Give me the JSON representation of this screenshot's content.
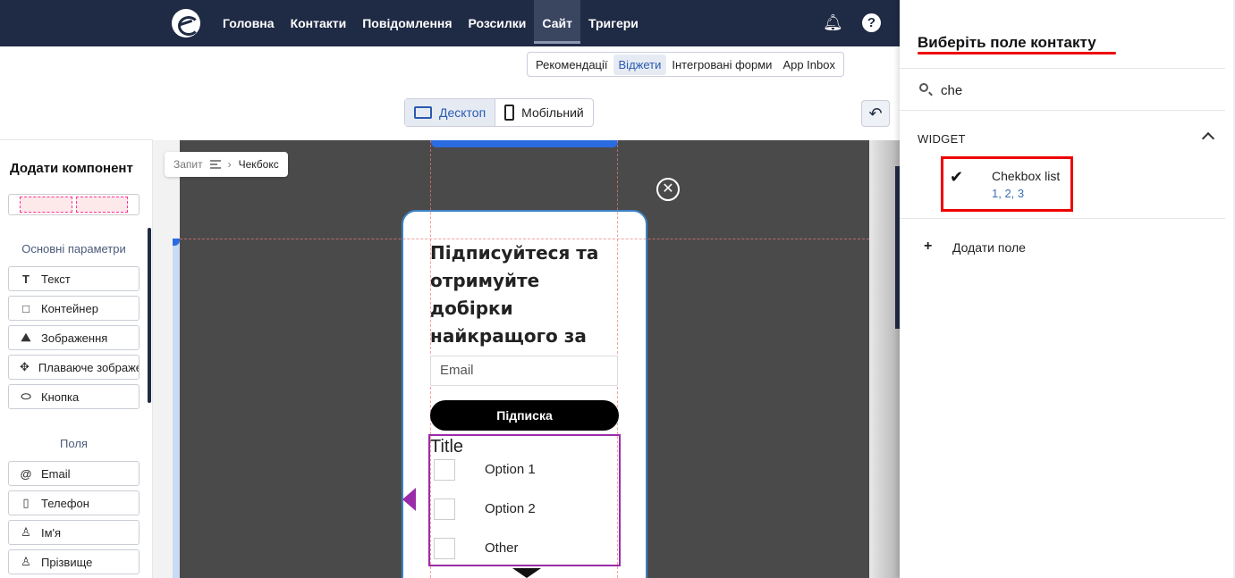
{
  "nav": {
    "items": [
      "Головна",
      "Контакти",
      "Повідомлення",
      "Розсилки",
      "Сайт",
      "Тригери"
    ],
    "active": "Сайт"
  },
  "subtabs": [
    "Рекомендації",
    "Віджети",
    "Інтегровані форми",
    "App Inbox"
  ],
  "active_subtab": "Віджети",
  "devices": {
    "desktop": "Десктоп",
    "mobile": "Мобільний",
    "active": "desktop"
  },
  "left_panel": {
    "title": "Додати компонент",
    "section_main": "Основні параметри",
    "main_items": [
      {
        "label": "Текст",
        "icon": "text-icon"
      },
      {
        "label": "Контейнер",
        "icon": "container-icon"
      },
      {
        "label": "Зображення",
        "icon": "image-icon"
      },
      {
        "label": "Плаваюче зображення",
        "icon": "floating-image-icon"
      },
      {
        "label": "Кнопка",
        "icon": "button-icon"
      }
    ],
    "section_fields": "Поля",
    "field_items": [
      {
        "label": "Email",
        "icon": "at-icon"
      },
      {
        "label": "Телефон",
        "icon": "phone-icon"
      },
      {
        "label": "Ім'я",
        "icon": "person-icon"
      },
      {
        "label": "Прізвище",
        "icon": "person-icon"
      }
    ]
  },
  "breadcrumb": {
    "parent": "Запит",
    "current": "Чекбокс"
  },
  "popup": {
    "headline": "Підписуйтеся та отримуйте добірки найкращого за тиждень",
    "email_placeholder": "Email",
    "button": "Підписка",
    "checkbox_title": "Title",
    "options": [
      "Option 1",
      "Option 2",
      "Other"
    ]
  },
  "right_panel": {
    "title": "Виберіть поле контакту",
    "search_value": "che",
    "group": "WIDGET",
    "item_name": "Chekbox list",
    "item_values": "1, 2, 3",
    "add_field": "Додати поле"
  },
  "colors": {
    "nav_bg": "#1f2a44",
    "accent": "#2a5bb0",
    "highlight_red": "#e00000",
    "selection_purple": "#9b2ca9"
  }
}
